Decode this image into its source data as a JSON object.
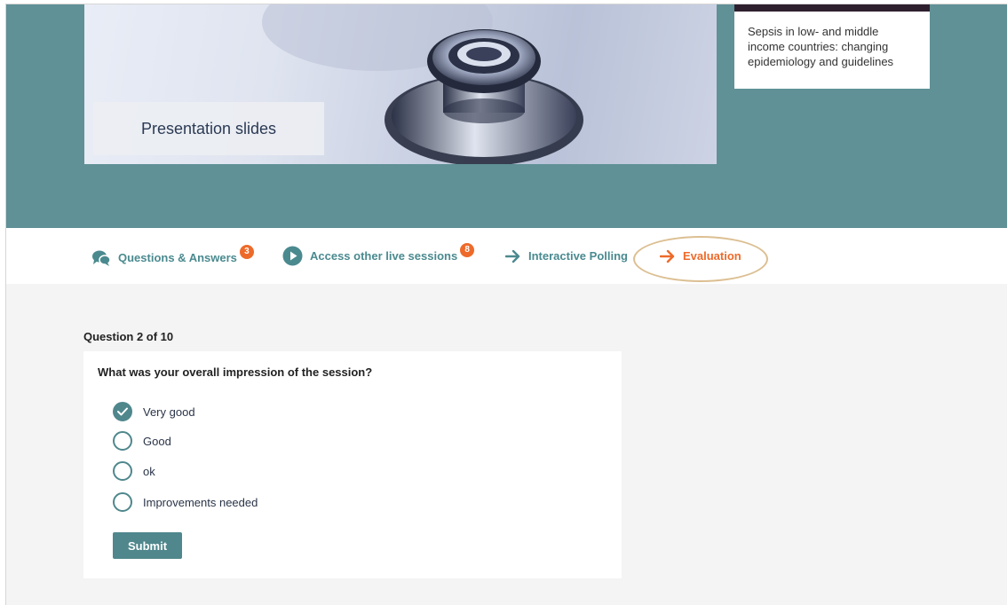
{
  "hero": {
    "slides_label": "Presentation slides",
    "session_title": "Sepsis in low- and middle income countries: changing epidemiology and guidelines"
  },
  "tabs": [
    {
      "label": "Questions & Answers",
      "icon": "chat-bubbles-icon",
      "badge": "3"
    },
    {
      "label": "Access other live sessions",
      "icon": "play-circle-icon",
      "badge": "8"
    },
    {
      "label": "Interactive Polling",
      "icon": "arrow-right-icon"
    },
    {
      "label": "Evaluation",
      "icon": "arrow-right-icon",
      "active": true
    }
  ],
  "survey": {
    "progress": "Question 2 of 10",
    "question": "What was your overall impression of the session?",
    "options": [
      {
        "label": "Very good",
        "checked": true
      },
      {
        "label": "Good",
        "checked": false
      },
      {
        "label": "ok",
        "checked": false
      },
      {
        "label": "Improvements needed",
        "checked": false
      }
    ],
    "submit_label": "Submit"
  },
  "colors": {
    "teal": "#5f9196",
    "accent": "#ee6a2a",
    "highlight": "#dcbf92"
  }
}
